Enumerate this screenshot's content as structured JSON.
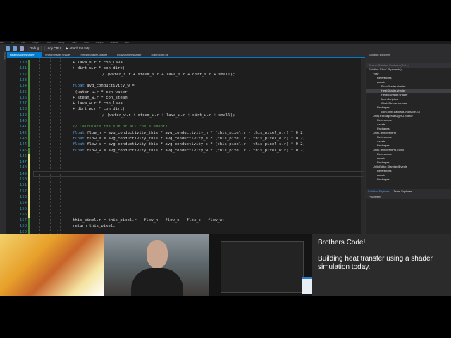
{
  "menu": [
    "File",
    "Edit",
    "View",
    "Project",
    "Build",
    "Debug",
    "Team",
    "Tools",
    "Analyze",
    "Window",
    "Help"
  ],
  "toolbar": {
    "config": "Debug",
    "platform": "Any CPU",
    "attach": "▶ Attach to Unity"
  },
  "tabs": [
    {
      "label": "HeatShader.shader*",
      "active": true
    },
    {
      "label": "WorldShader.shader"
    },
    {
      "label": "HeightShader.shader"
    },
    {
      "label": "FlowShader.shader"
    },
    {
      "label": "MainScript.cs"
    }
  ],
  "left_strip": "Toolbox",
  "code": [
    {
      "n": "130",
      "t": "+ lava_s.r * con_lava",
      "i": 0
    },
    {
      "n": "131",
      "t": "+ dirt_s.r * con_dirt)",
      "i": 0
    },
    {
      "n": "132",
      "t": "/ (water_s.r + steam_s.r + lava_s.r + dirt_s.r + small);",
      "i": 1
    },
    {
      "n": "133",
      "t": "",
      "i": 0
    },
    {
      "n": "134",
      "kw": "float",
      "t": " avg_conductivity_w =",
      "i": 0
    },
    {
      "n": "135",
      "t": " (water_w.r * con_water",
      "i": 0
    },
    {
      "n": "136",
      "t": "+ steam_w.r * con_steam",
      "i": 0
    },
    {
      "n": "137",
      "t": "+ lava_w.r * con_lava",
      "i": 0
    },
    {
      "n": "138",
      "t": "+ dirt_w.r * con_dirt)",
      "i": 0
    },
    {
      "n": "139",
      "t": "/ (water_w.r + steam_w.r + lava_w.r + dirt_w.r + small);",
      "i": 1
    },
    {
      "n": "140",
      "t": "",
      "i": 0
    },
    {
      "n": "141",
      "cm": "// Calculate the sum of all the elements",
      "t": "",
      "i": 0
    },
    {
      "n": "142",
      "kw": "float",
      "t": " flow_n = avg_conductivity_this * avg_conductivity_n * (this_pixel.r - this_pixel_n.r) * 0.2;",
      "i": 0
    },
    {
      "n": "143",
      "kw": "float",
      "t": " flow_e = avg_conductivity_this * avg_conductivity_e * (this_pixel.r - this_pixel_e.r) * 0.2;",
      "i": 0
    },
    {
      "n": "144",
      "kw": "float",
      "t": " flow_s = avg_conductivity_this * avg_conductivity_s * (this_pixel.r - this_pixel_s.r) * 0.2;",
      "i": 0
    },
    {
      "n": "145",
      "kw": "float",
      "t": " flow_w = avg_conductivity_this * avg_conductivity_w * (this_pixel.r - this_pixel_w.r) * 0.2;",
      "i": 0
    },
    {
      "n": "146",
      "t": "",
      "i": 0
    },
    {
      "n": "147",
      "t": "",
      "i": 0
    },
    {
      "n": "148",
      "t": "",
      "i": 0
    },
    {
      "n": "149",
      "t": "",
      "i": 0
    },
    {
      "n": "150",
      "t": "",
      "i": 0
    },
    {
      "n": "151",
      "t": "",
      "i": 0
    },
    {
      "n": "152",
      "t": "",
      "i": 0
    },
    {
      "n": "153",
      "t": "",
      "i": 0
    },
    {
      "n": "154",
      "t": "",
      "i": 0
    },
    {
      "n": "155",
      "t": "",
      "i": 0
    },
    {
      "n": "156",
      "t": "",
      "i": 0
    },
    {
      "n": "157",
      "t": "this_pixel.r = this_pixel.r - flow_n - flow_e - flow_s - flow_w;",
      "i": 0
    },
    {
      "n": "158",
      "t": "return this_pixel;",
      "i": 0
    },
    {
      "n": "159",
      "t": "}",
      "i": -1
    }
  ],
  "solution_explorer": {
    "title": "Solution Explorer",
    "search": "Search Solution Explorer (Ctrl+;)",
    "items": [
      {
        "label": "Solution 'Flow' (5 projects)",
        "d": 0
      },
      {
        "label": "Flow",
        "d": 1
      },
      {
        "label": "References",
        "d": 2
      },
      {
        "label": "Assets",
        "d": 2
      },
      {
        "label": "FlowShader.shader",
        "d": 3
      },
      {
        "label": "HeatShader.shader",
        "d": 3,
        "sel": true
      },
      {
        "label": "HeightShader.shader",
        "d": 3
      },
      {
        "label": "MainScript.cs",
        "d": 3
      },
      {
        "label": "WorldShader.shader",
        "d": 3
      },
      {
        "label": "Packages",
        "d": 2
      },
      {
        "label": "com.unity.package-manager-ui",
        "d": 3
      },
      {
        "label": "Unity.PackageManagerUI.Editor",
        "d": 1
      },
      {
        "label": "References",
        "d": 2
      },
      {
        "label": "Assets",
        "d": 2
      },
      {
        "label": "Packages",
        "d": 2
      },
      {
        "label": "Unity.TextMeshPro",
        "d": 1
      },
      {
        "label": "References",
        "d": 2
      },
      {
        "label": "Assets",
        "d": 2
      },
      {
        "label": "Packages",
        "d": 2
      },
      {
        "label": "Unity.TextMeshPro.Editor",
        "d": 1
      },
      {
        "label": "References",
        "d": 2
      },
      {
        "label": "Assets",
        "d": 2
      },
      {
        "label": "Packages",
        "d": 2
      },
      {
        "label": "UnityEditor.StandardEvents",
        "d": 1
      },
      {
        "label": "References",
        "d": 2
      },
      {
        "label": "Assets",
        "d": 2
      },
      {
        "label": "Packages",
        "d": 2
      }
    ],
    "tabs": [
      "Solution Explorer",
      "Team Explorer"
    ],
    "properties_title": "Properties"
  },
  "overlay": {
    "title": "Brothers Code!",
    "message": "Building heat transfer using a shader simulation today."
  }
}
